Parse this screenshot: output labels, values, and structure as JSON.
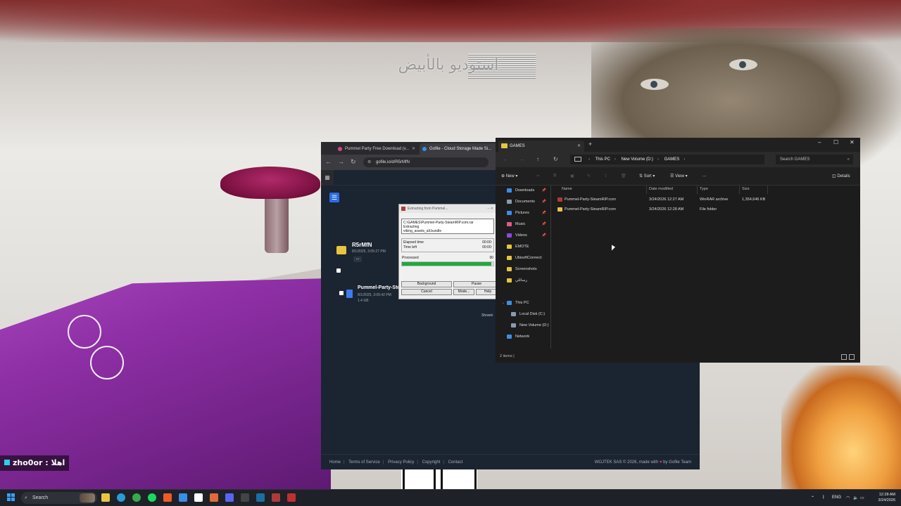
{
  "background": {
    "banner_text": "استوديو بالأبيض",
    "chat_overlay": "zho0or : اهلا"
  },
  "browser": {
    "tabs": [
      {
        "label": "Pummel Party Free Download (v..."
      },
      {
        "label": "Gofile - Cloud Storage Made Si..."
      }
    ],
    "url": "gofile.io/d/R5rMfN",
    "folder": {
      "name": "R5rMfN",
      "date": "8/1/2025, 3:05:27 PM",
      "more": "..."
    },
    "file": {
      "name": "Pummel-Party-SteamRIP.com.rar",
      "date": "8/1/2025, 3:05:42 PM",
      "size": "1.4 GB"
    },
    "showing": "Showin",
    "footer": {
      "links": [
        "Home",
        "Terms of Service",
        "Privacy Policy",
        "Copyright",
        "Contact"
      ],
      "credit_prefix": "WOJTEK SAS © 2026, made with",
      "credit_suffix": "by Gofile Team"
    }
  },
  "winrar": {
    "title": "Extracting from Pummel...",
    "path_line1": "C:\\GAMES\\Pummel-Party-SteamRIP.com.rar",
    "path_line2": "Extracting",
    "path_line3": "viking_assets_all.bundle",
    "elapsed_label": "Elapsed time",
    "elapsed_value": "00:00:",
    "left_label": "Time left",
    "left_value": "00:00:",
    "processed_label": "Processed",
    "processed_value": "90",
    "progress_fraction": 0.98,
    "buttons": {
      "background": "Background",
      "pause": "Pause",
      "cancel": "Cancel",
      "mode": "Mode...",
      "help": "Help"
    }
  },
  "explorer": {
    "tab_title": "GAMES",
    "breadcrumbs": [
      "This PC",
      "New Volume (D:)",
      "GAMES"
    ],
    "search_placeholder": "Search GAMES",
    "toolbar": {
      "new": "New",
      "sort": "Sort",
      "view": "View",
      "more": "...",
      "details": "Details"
    },
    "sidebar": [
      {
        "label": "Downloads",
        "color": "#3a8ee8",
        "pinned": true
      },
      {
        "label": "Documents",
        "color": "#8a9ab0",
        "pinned": true
      },
      {
        "label": "Pictures",
        "color": "#3a8ee8",
        "pinned": true
      },
      {
        "label": "Music",
        "color": "#e05a8a",
        "pinned": true
      },
      {
        "label": "Videos",
        "color": "#8a4ae0",
        "pinned": true
      },
      {
        "label": "EMOTE",
        "color": "#e8c440",
        "pinned": false
      },
      {
        "label": "UbisoftConnect",
        "color": "#e8c440",
        "pinned": false
      },
      {
        "label": "Screenshots",
        "color": "#e8c440",
        "pinned": false
      },
      {
        "label": "رسائلي",
        "color": "#e8c440",
        "pinned": false
      }
    ],
    "tree": [
      {
        "label": "This PC",
        "color": "#3a8ee8"
      },
      {
        "label": "Local Disk (C:)",
        "color": "#8a9ab0"
      },
      {
        "label": "New Volume (D:)",
        "color": "#8a9ab0"
      },
      {
        "label": "Network",
        "color": "#3a8ee8"
      }
    ],
    "columns": {
      "name": "Name",
      "date": "Date modified",
      "type": "Type",
      "size": "Size"
    },
    "rows": [
      {
        "name": "Pummel-Party-SteamRIP.com",
        "date": "3/24/2026 12:27 AM",
        "type": "WinRAR archive",
        "size": "1,354,646 KB",
        "icon_color": "#b03a3a"
      },
      {
        "name": "Pummel-Party-SteamRIP.com",
        "date": "3/24/2026 12:28 AM",
        "type": "File folder",
        "size": "",
        "icon_color": "#e8c440"
      }
    ],
    "status": "2 items"
  },
  "taskbar": {
    "search": "Search",
    "lang": "ENG",
    "time": "12:28 AM",
    "date": "3/24/2026",
    "apps": [
      {
        "name": "file-explorer-icon",
        "color": "#e8c440"
      },
      {
        "name": "edge-icon",
        "color": "#2a9ad8"
      },
      {
        "name": "chrome-icon",
        "color": "#3aa84a"
      },
      {
        "name": "spotify-icon",
        "color": "#1ed760"
      },
      {
        "name": "brave-icon",
        "color": "#f05a28"
      },
      {
        "name": "store-icon",
        "color": "#3a8ee8"
      },
      {
        "name": "capcut-icon",
        "color": "#ffffff"
      },
      {
        "name": "app-icon",
        "color": "#e06a3a"
      },
      {
        "name": "discord-icon",
        "color": "#5865f2"
      },
      {
        "name": "terminal-icon",
        "color": "#444"
      },
      {
        "name": "steam-icon",
        "color": "#1b6ea0"
      },
      {
        "name": "winrar-icon",
        "color": "#b03a3a"
      },
      {
        "name": "obs-icon",
        "color": "#c03030"
      }
    ]
  }
}
